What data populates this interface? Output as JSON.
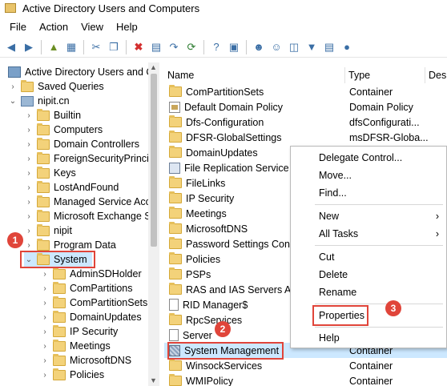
{
  "window": {
    "title": "Active Directory Users and Computers"
  },
  "menu": [
    "File",
    "Action",
    "View",
    "Help"
  ],
  "toolbar": [
    "back-icon",
    "forward-icon",
    "up-folder-icon",
    "show-tree-icon",
    "cut-icon",
    "copy-icon",
    "delete-icon",
    "properties-icon",
    "export-icon",
    "help-icon",
    "new-user-icon",
    "new-group-icon",
    "new-ou-icon",
    "filter-icon",
    "add-to-group-icon",
    "find-icon"
  ],
  "tree": {
    "root": "Active Directory Users and Co",
    "saved_queries": "Saved Queries",
    "domain": "nipit.cn",
    "items": [
      "Builtin",
      "Computers",
      "Domain Controllers",
      "ForeignSecurityPrinci",
      "Keys",
      "LostAndFound",
      "Managed Service Acc",
      "Microsoft Exchange S",
      "nipit",
      "Program Data",
      "System"
    ],
    "system_children": [
      "AdminSDHolder",
      "ComPartitions",
      "ComPartitionSets",
      "DomainUpdates",
      "IP Security",
      "Meetings",
      "MicrosoftDNS",
      "Policies"
    ]
  },
  "list": {
    "headers": [
      "Name",
      "Type",
      "Des"
    ],
    "rows": [
      {
        "name": "ComPartitionSets",
        "type": "Container",
        "icon": "folder"
      },
      {
        "name": "Default Domain Policy",
        "type": "Domain Policy",
        "icon": "policy"
      },
      {
        "name": "Dfs-Configuration",
        "type": "dfsConfigurati...",
        "icon": "folder"
      },
      {
        "name": "DFSR-GlobalSettings",
        "type": "msDFSR-Globa...",
        "icon": "folder"
      },
      {
        "name": "DomainUpdates",
        "type": "",
        "icon": "folder"
      },
      {
        "name": "File Replication Service",
        "type": "",
        "icon": "repl"
      },
      {
        "name": "FileLinks",
        "type": "",
        "icon": "folder"
      },
      {
        "name": "IP Security",
        "type": "",
        "icon": "folder"
      },
      {
        "name": "Meetings",
        "type": "",
        "icon": "folder"
      },
      {
        "name": "MicrosoftDNS",
        "type": "",
        "icon": "folder"
      },
      {
        "name": "Password Settings Contair",
        "type": "",
        "icon": "folder"
      },
      {
        "name": "Policies",
        "type": "",
        "icon": "folder"
      },
      {
        "name": "PSPs",
        "type": "",
        "icon": "folder"
      },
      {
        "name": "RAS and IAS Servers Acces",
        "type": "",
        "icon": "folder"
      },
      {
        "name": "RID Manager$",
        "type": "",
        "icon": "doc"
      },
      {
        "name": "RpcServices",
        "type": "",
        "icon": "folder"
      },
      {
        "name": "Server",
        "type": "",
        "icon": "doc"
      },
      {
        "name": "System Management",
        "type": "Container",
        "icon": "sysmgmt"
      },
      {
        "name": "WinsockServices",
        "type": "Container",
        "icon": "folder"
      },
      {
        "name": "WMIPolicy",
        "type": "Container",
        "icon": "folder"
      }
    ]
  },
  "context_menu": {
    "delegate": "Delegate Control...",
    "move": "Move...",
    "find": "Find...",
    "new": "New",
    "all_tasks": "All Tasks",
    "cut": "Cut",
    "delete": "Delete",
    "rename": "Rename",
    "properties": "Properties",
    "help": "Help",
    "arrow": "›"
  },
  "badges": [
    "1",
    "2",
    "3"
  ],
  "accent": "#e0453a"
}
